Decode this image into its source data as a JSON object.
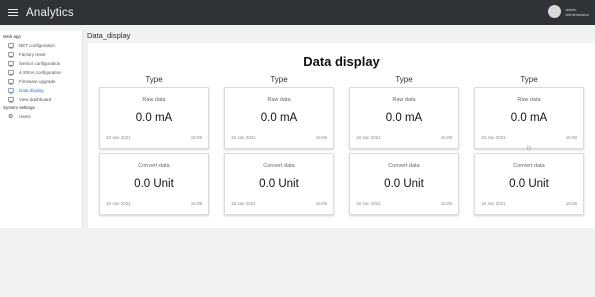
{
  "header": {
    "logo": "Analytics",
    "user_line1": "admin",
    "user_line2": "Administrator"
  },
  "sidebar": {
    "section_webapp": "Web app",
    "items": [
      {
        "label": "NET configuration",
        "icon": "monitor-icon"
      },
      {
        "label": "Factory reset",
        "icon": "monitor-icon"
      },
      {
        "label": "Sensor configuration",
        "icon": "monitor-icon"
      },
      {
        "label": "4-20mA configuration",
        "icon": "monitor-icon"
      },
      {
        "label": "Firmware upgrade",
        "icon": "monitor-icon"
      },
      {
        "label": "Data display",
        "icon": "monitor-icon",
        "active": true
      },
      {
        "label": "View dashboard",
        "icon": "monitor-icon"
      }
    ],
    "section_system": "System settings",
    "system_items": [
      {
        "label": "Users",
        "icon": "gear-icon"
      }
    ]
  },
  "breadcrumb": "Data_display",
  "page": {
    "title": "Data display"
  },
  "columns": [
    {
      "type_label": "Type",
      "raw": {
        "label": "Raw data",
        "value": "0.0 mA",
        "date": "18 Jan 2021",
        "time": "15:09"
      },
      "convert": {
        "label": "Convert data",
        "value": "0.0 Unit",
        "date": "18 Jan 2021",
        "time": "15:09"
      }
    },
    {
      "type_label": "Type",
      "raw": {
        "label": "Raw data",
        "value": "0.0 mA",
        "date": "18 Jan 2021",
        "time": "15:09"
      },
      "convert": {
        "label": "Convert data",
        "value": "0.0 Unit",
        "date": "18 Jan 2021",
        "time": "15:09"
      }
    },
    {
      "type_label": "Type",
      "raw": {
        "label": "Raw data",
        "value": "0.0 mA",
        "date": "18 Jan 2021",
        "time": "15:09"
      },
      "convert": {
        "label": "Convert data",
        "value": "0.0 Unit",
        "date": "18 Jan 2021",
        "time": "15:09"
      }
    },
    {
      "type_label": "Type",
      "raw": {
        "label": "Raw data",
        "value": "0.0 mA",
        "date": "18 Jan 2021",
        "time": "15:09"
      },
      "convert": {
        "label": "Convert data",
        "value": "0.0 Unit",
        "date": "18 Jan 2021",
        "time": "15:09"
      }
    }
  ],
  "colors": {
    "topbar": "#2f3237",
    "accent": "#2f6fd6",
    "background": "#f1f2f4"
  }
}
